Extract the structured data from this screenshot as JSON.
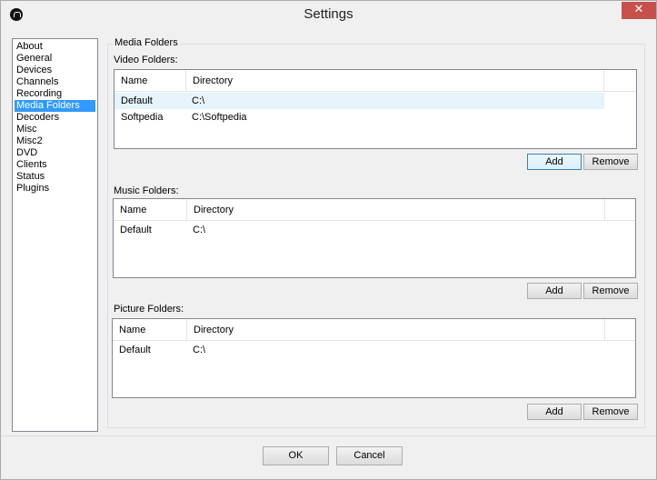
{
  "window": {
    "title": "Settings",
    "close_glyph": "✕",
    "app_icon": "app-logo-icon"
  },
  "nav": {
    "items": [
      {
        "label": "About"
      },
      {
        "label": "General"
      },
      {
        "label": "Devices"
      },
      {
        "label": "Channels"
      },
      {
        "label": "Recording"
      },
      {
        "label": "Media Folders",
        "selected": true
      },
      {
        "label": "Decoders"
      },
      {
        "label": "Misc"
      },
      {
        "label": "Misc2"
      },
      {
        "label": "DVD"
      },
      {
        "label": "Clients"
      },
      {
        "label": "Status"
      },
      {
        "label": "Plugins"
      }
    ]
  },
  "media": {
    "group_caption": "Media Folders",
    "video": {
      "label": "Video Folders:",
      "columns": [
        "Name",
        "Directory"
      ],
      "rows": [
        {
          "name": "Default",
          "directory": "C:\\"
        },
        {
          "name": "Softpedia",
          "directory": "C:\\Softpedia"
        }
      ],
      "add_label": "Add",
      "remove_label": "Remove"
    },
    "music": {
      "label": "Music Folders:",
      "columns": [
        "Name",
        "Directory"
      ],
      "rows": [
        {
          "name": "Default",
          "directory": "C:\\"
        }
      ],
      "add_label": "Add",
      "remove_label": "Remove"
    },
    "picture": {
      "label": "Picture Folders:",
      "columns": [
        "Name",
        "Directory"
      ],
      "rows": [
        {
          "name": "Default",
          "directory": "C:\\"
        }
      ],
      "add_label": "Add",
      "remove_label": "Remove"
    }
  },
  "footer": {
    "ok_label": "OK",
    "cancel_label": "Cancel"
  },
  "colors": {
    "selection": "#3399ff",
    "close_button": "#c7504c"
  }
}
